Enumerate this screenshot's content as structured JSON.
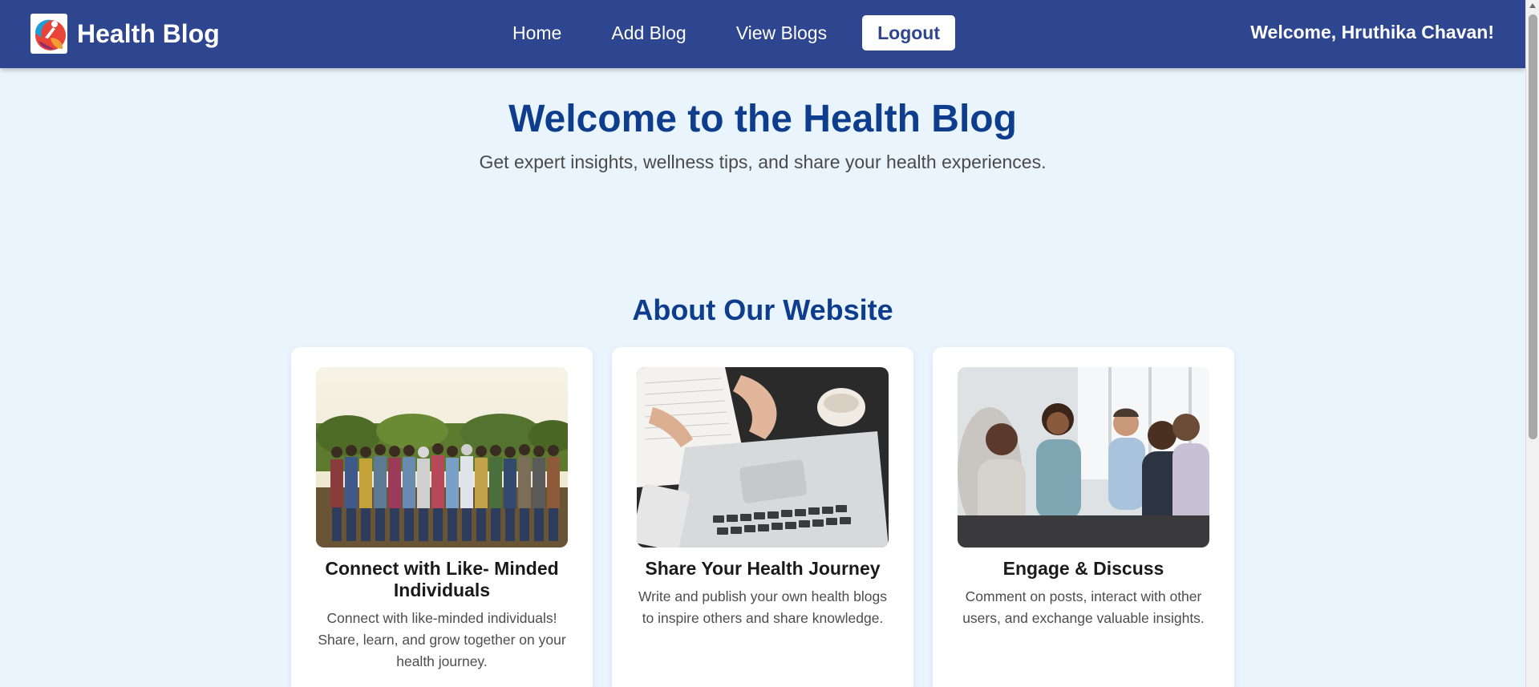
{
  "header": {
    "brand_title": "Health Blog",
    "nav": [
      {
        "label": "Home"
      },
      {
        "label": "Add Blog"
      },
      {
        "label": "View Blogs"
      }
    ],
    "logout_label": "Logout",
    "welcome_text": "Welcome, Hruthika Chavan!"
  },
  "hero": {
    "title": "Welcome to the Health Blog",
    "subtitle": "Get expert insights, wellness tips, and share your health experiences."
  },
  "about": {
    "title": "About Our Website",
    "cards": [
      {
        "title": "Connect with Like- Minded Individuals",
        "text": "Connect with like-minded individuals! Share, learn, and grow together on your health journey.",
        "image": "group-of-people-arms-around-photo"
      },
      {
        "title": "Share Your Health Journey",
        "text": "Write and publish your own health blogs to inspire others and share knowledge.",
        "image": "laptop-notebook-writing-photo"
      },
      {
        "title": "Engage & Discuss",
        "text": "Comment on posts, interact with other users, and exchange valuable insights.",
        "image": "group-discussion-photo"
      }
    ]
  },
  "colors": {
    "navbar": "#2e4590",
    "page_background": "#eaf4fc",
    "heading": "#0d3d8c"
  }
}
